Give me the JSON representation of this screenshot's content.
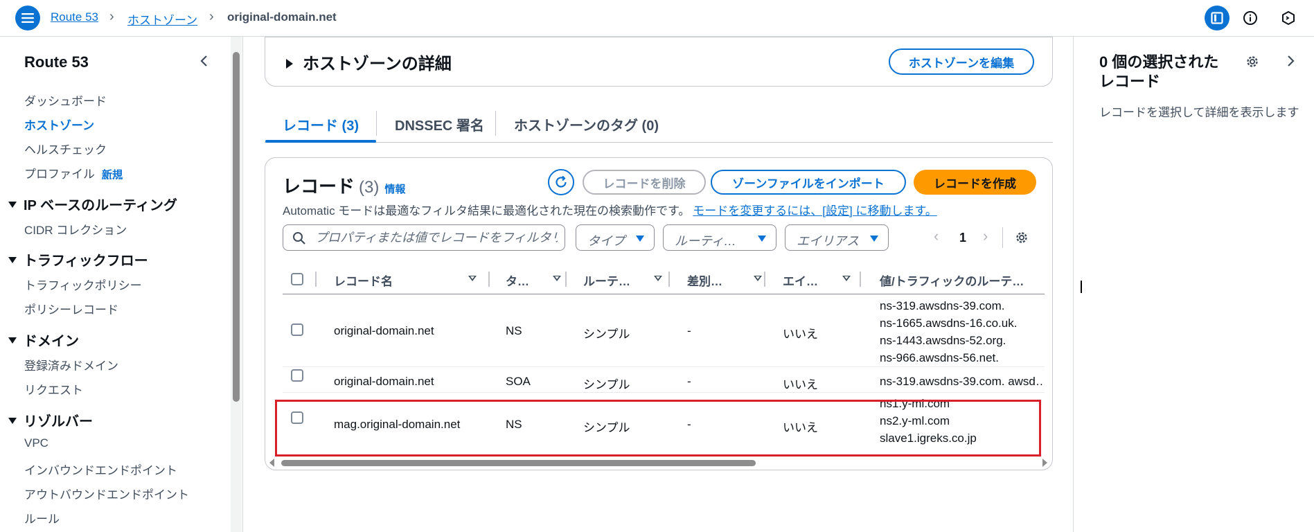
{
  "topbar": {
    "breadcrumbs": [
      "Route 53",
      "ホストゾーン",
      "original-domain.net"
    ]
  },
  "nav": {
    "title": "Route 53",
    "items_top": [
      "ダッシュボード",
      "ホストゾーン",
      "ヘルスチェック",
      "プロファイル"
    ],
    "new_badge": "新規",
    "sections": [
      {
        "title": "IP ベースのルーティング",
        "items": [
          "CIDR コレクション"
        ]
      },
      {
        "title": "トラフィックフロー",
        "items": [
          "トラフィックポリシー",
          "ポリシーレコード"
        ]
      },
      {
        "title": "ドメイン",
        "items": [
          "登録済みドメイン",
          "リクエスト"
        ]
      },
      {
        "title": "リゾルバー",
        "items": [
          "VPC",
          "インバウンドエンドポイント",
          "アウトバウンドエンドポイント",
          "ルール"
        ]
      }
    ]
  },
  "hosted_zone": {
    "details_title": "ホストゾーンの詳細",
    "edit_button": "ホストゾーンを編集"
  },
  "tabs": [
    "レコード (3)",
    "DNSSEC 署名",
    "ホストゾーンのタグ (0)"
  ],
  "records": {
    "title": "レコード",
    "count": "(3)",
    "info": "情報",
    "delete_button": "レコードを削除",
    "import_button": "ゾーンファイルをインポート",
    "create_button": "レコードを作成",
    "mode_text": "Automatic モードは最適なフィルタ結果に最適化された現在の検索動作です。",
    "mode_link": "モードを変更するには、[設定] に移動します。",
    "search_placeholder": "プロパティまたは値でレコードをフィルタリ",
    "filter_type": "タイプ",
    "filter_routing": "ルーティ…",
    "filter_alias": "エイリアス",
    "page": "1",
    "columns": [
      "レコード名",
      "タ…",
      "ルーテ…",
      "差別…",
      "エイ…",
      "値/トラフィックのルーテ…"
    ],
    "rows": [
      {
        "name": "original-domain.net",
        "type": "NS",
        "routing": "シンプル",
        "diff": "-",
        "alias": "いいえ",
        "values": [
          "ns-319.awsdns-39.com.",
          "ns-1665.awsdns-16.co.uk.",
          "ns-1443.awsdns-52.org.",
          "ns-966.awsdns-56.net."
        ]
      },
      {
        "name": "original-domain.net",
        "type": "SOA",
        "routing": "シンプル",
        "diff": "-",
        "alias": "いいえ",
        "values": [
          "ns-319.awsdns-39.com. awsd…"
        ]
      },
      {
        "name": "mag.original-domain.net",
        "type": "NS",
        "routing": "シンプル",
        "diff": "-",
        "alias": "いいえ",
        "values": [
          "ns1.y-ml.com",
          "ns2.y-ml.com",
          "slave1.igreks.co.jp"
        ]
      }
    ]
  },
  "right_panel": {
    "title": "0 個の選択された レコード",
    "description": "レコードを選択して詳細を表示します"
  },
  "colors": {
    "accent": "#0972d3",
    "primary_button": "#ff9900",
    "highlight_border": "#d9202a"
  },
  "icons": [
    "menu-icon",
    "chevron-right-icon",
    "panel-icon",
    "info-icon",
    "cloudshell-icon",
    "chevron-left-icon",
    "caret-down-icon",
    "refresh-icon",
    "search-icon",
    "gear-icon"
  ]
}
